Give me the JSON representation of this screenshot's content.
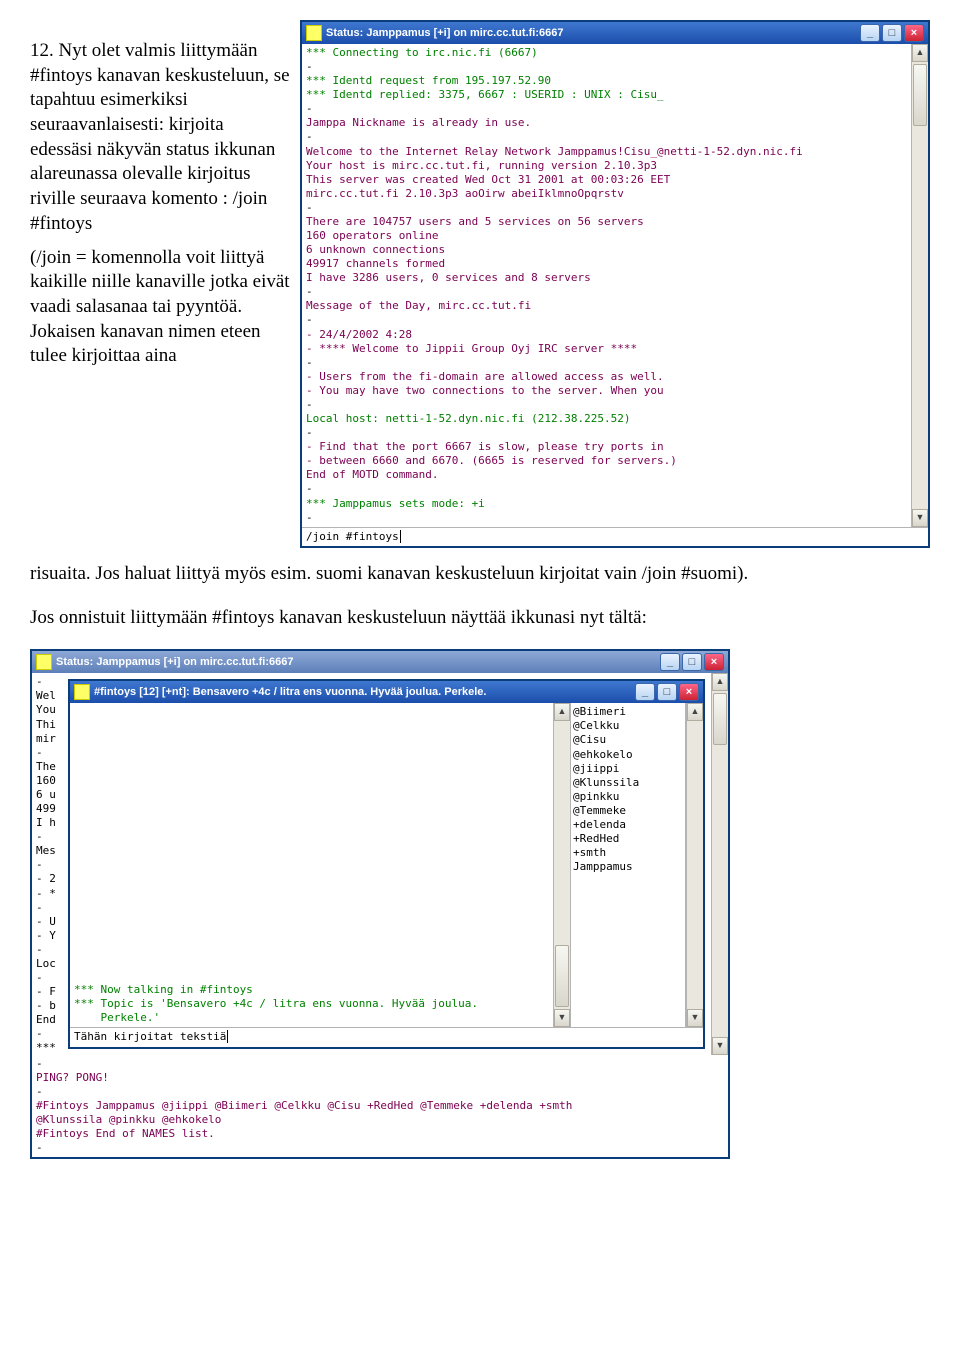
{
  "doc": {
    "para1_runs": [
      "12. Nyt olet valmis liittymään #fintoys kanavan keskusteluun, se tapahtuu esimerkiksi seuraavanlaisesti: kirjoita edessäsi näkyvän status ikkunan alareunassa olevalle kirjoitus riville seuraava komento : /join #fintoys",
      "(/join = komennolla voit liittyä kaikille niille kanaville jotka eivät vaadi salasanaa tai pyyntöä. Jokaisen kanavan nimen eteen tulee kirjoittaa aina"
    ],
    "para1_tail": "risuaita. Jos haluat liittyä myös esim. suomi kanavan keskusteluun kirjoitat vain /join #suomi).",
    "para2": "Jos onnistuit liittymään #fintoys kanavan keskusteluun näyttää ikkunasi nyt tältä:"
  },
  "shot1": {
    "title": "Status: Jamppamus [+i] on mirc.cc.tut.fi:6667",
    "lines": [
      {
        "c": "g",
        "t": "*** Connecting to irc.nic.fi (6667)"
      },
      {
        "c": "b",
        "t": "-"
      },
      {
        "c": "g",
        "t": "*** Identd request from 195.197.52.90"
      },
      {
        "c": "g",
        "t": "*** Identd replied: 3375, 6667 : USERID : UNIX : Cisu_"
      },
      {
        "c": "b",
        "t": "-"
      },
      {
        "c": "m",
        "t": "Jamppa Nickname is already in use."
      },
      {
        "c": "b",
        "t": "-"
      },
      {
        "c": "m",
        "t": "Welcome to the Internet Relay Network Jamppamus!Cisu_@netti-1-52.dyn.nic.fi"
      },
      {
        "c": "m",
        "t": "Your host is mirc.cc.tut.fi, running version 2.10.3p3"
      },
      {
        "c": "m",
        "t": "This server was created Wed Oct 31 2001 at 00:03:26 EET"
      },
      {
        "c": "m",
        "t": "mirc.cc.tut.fi 2.10.3p3 aoOirw abeiIklmnoOpqrstv"
      },
      {
        "c": "b",
        "t": "-"
      },
      {
        "c": "m",
        "t": "There are 104757 users and 5 services on 56 servers"
      },
      {
        "c": "m",
        "t": "160 operators online"
      },
      {
        "c": "m",
        "t": "6 unknown connections"
      },
      {
        "c": "m",
        "t": "49917 channels formed"
      },
      {
        "c": "m",
        "t": "I have 3286 users, 0 services and 8 servers"
      },
      {
        "c": "b",
        "t": "-"
      },
      {
        "c": "m",
        "t": "Message of the Day, mirc.cc.tut.fi"
      },
      {
        "c": "b",
        "t": "-"
      },
      {
        "c": "m",
        "t": "- 24/4/2002 4:28"
      },
      {
        "c": "m",
        "t": "- **** Welcome to Jippii Group Oyj IRC server ****"
      },
      {
        "c": "b",
        "t": "-"
      },
      {
        "c": "m",
        "t": "- Users from the fi-domain are allowed access as well."
      },
      {
        "c": "m",
        "t": "- You may have two connections to the server. When you"
      },
      {
        "c": "b",
        "t": "-"
      },
      {
        "c": "g",
        "t": "Local host: netti-1-52.dyn.nic.fi (212.38.225.52)"
      },
      {
        "c": "b",
        "t": "-"
      },
      {
        "c": "m",
        "t": "- Find that the port 6667 is slow, please try ports in"
      },
      {
        "c": "m",
        "t": "- between 6660 and 6670. (6665 is reserved for servers.)"
      },
      {
        "c": "m",
        "t": "End of MOTD command."
      },
      {
        "c": "b",
        "t": "-"
      },
      {
        "c": "g",
        "t": "*** Jamppamus sets mode: +i"
      },
      {
        "c": "b",
        "t": "-"
      }
    ],
    "input": "/join #fintoys"
  },
  "shot2": {
    "outer_title": "Status: Jamppamus [+i] on mirc.cc.tut.fi:6667",
    "inner_title": "#fintoys [12] [+nt]: Bensavero +4c / litra ens vuonna. Hyvää joulua. Perkele.",
    "users": [
      "@Biimeri",
      "@Celkku",
      "@Cisu",
      "@ehkokelo",
      "@jiippi",
      "@Klunssila",
      "@pinkku",
      "@Temmeke",
      "+delenda",
      "+RedHed",
      "+smth",
      "Jamppamus"
    ],
    "behind_frags": [
      "-",
      "Wel",
      "You",
      "Thi",
      "mir",
      "-",
      "The",
      "160",
      "6 u",
      "499",
      "I h",
      "-",
      "Mes",
      "-",
      "- 2",
      "- *",
      "-",
      "- U",
      "- Y",
      "-",
      "Loc",
      "-",
      "- F",
      "- b",
      "End",
      "-",
      "***"
    ],
    "chan_lines": [
      {
        "c": "g",
        "t": "*** Now talking in #fintoys"
      },
      {
        "c": "g",
        "t": "*** Topic is 'Bensavero +4c / litra ens vuonna. Hyvää joulua."
      },
      {
        "c": "g",
        "t": "    Perkele.'"
      }
    ],
    "chan_input": "Tähän kirjoitat tekstiä",
    "status_tail": [
      {
        "c": "b",
        "t": "-"
      },
      {
        "c": "m",
        "t": "PING? PONG!"
      },
      {
        "c": "b",
        "t": "-"
      },
      {
        "c": "m",
        "t": "#Fintoys Jamppamus @jiippi @Biimeri @Celkku @Cisu +RedHed @Temmeke +delenda +smth"
      },
      {
        "c": "m",
        "t": "         @Klunssila @pinkku @ehkokelo"
      },
      {
        "c": "m",
        "t": "#Fintoys End of NAMES list."
      },
      {
        "c": "b",
        "t": "-"
      }
    ]
  },
  "glyph": {
    "min": "_",
    "max": "□",
    "close": "×",
    "up": "▲",
    "down": "▼"
  }
}
